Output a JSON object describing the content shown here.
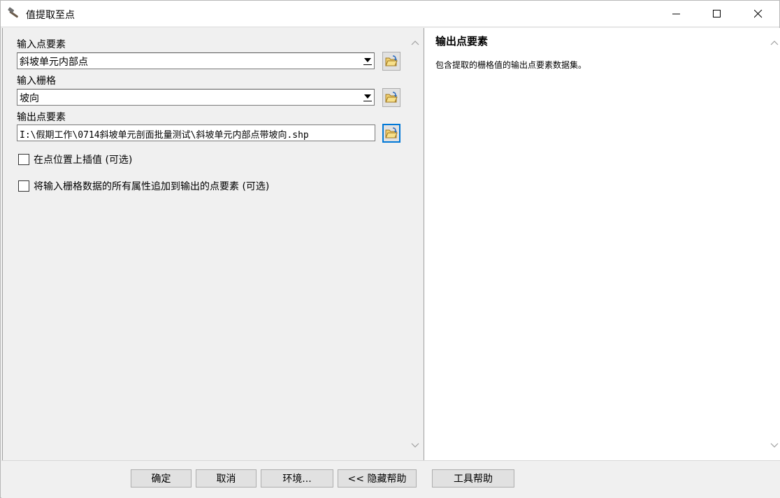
{
  "window": {
    "title": "值提取至点",
    "app_icon": "hammer-icon",
    "controls": [
      "minimize-icon",
      "maximize-icon",
      "close-icon"
    ]
  },
  "form": {
    "input_points": {
      "label": "输入点要素",
      "value": "斜坡单元内部点"
    },
    "input_raster": {
      "label": "输入栅格",
      "value": "坡向"
    },
    "output_points": {
      "label": "输出点要素",
      "value": "I:\\假期工作\\0714斜坡单元剖面批量测试\\斜坡单元内部点带坡向.shp"
    },
    "interpolate": {
      "label": "在点位置上插值 (可选)",
      "checked": false
    },
    "append_attrs": {
      "label": "将输入栅格数据的所有属性追加到输出的点要素 (可选)",
      "checked": false
    }
  },
  "help": {
    "title": "输出点要素",
    "text": "包含提取的栅格值的输出点要素数据集。"
  },
  "buttons": {
    "ok": "确定",
    "cancel": "取消",
    "env": "环境...",
    "hide_help": "<< 隐藏帮助",
    "tool_help": "工具帮助"
  },
  "colors": {
    "focus_border": "#0078d7",
    "folder_yellow": "#e8c060"
  }
}
